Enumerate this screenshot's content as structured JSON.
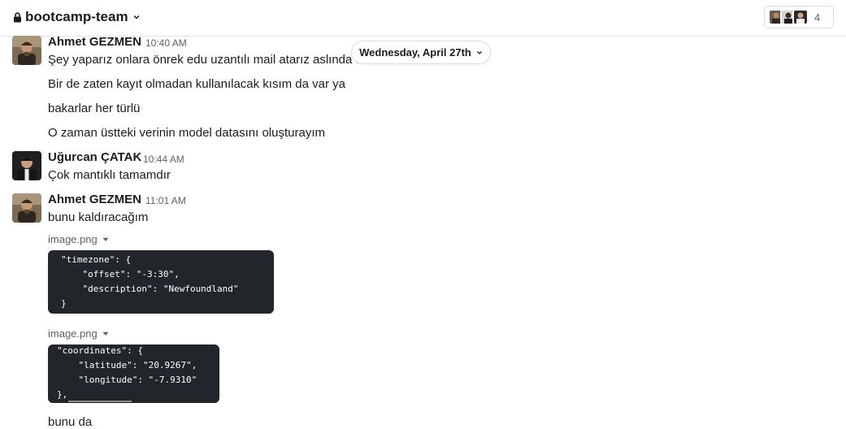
{
  "header": {
    "channel_name": "bootcamp-team",
    "member_count": "4"
  },
  "date_divider": {
    "label": "Wednesday, April 27th"
  },
  "messages": [
    {
      "author": "Ahmet GEZMEN",
      "time": "10:40 AM",
      "lines": [
        "Şey yaparız onlara önrek edu uzantılı mail atarız aslında olur",
        "Bir de zaten kayıt olmadan kullanılacak kısım da var ya",
        "bakarlar her türlü",
        "O zaman üstteki verinin model datasını oluşturayım"
      ]
    },
    {
      "author": "Uğurcan ÇATAK",
      "time": "10:44 AM",
      "lines": [
        "Çok mantıklı tamamdır"
      ]
    },
    {
      "author": "Ahmet GEZMEN",
      "time": "11:01 AM",
      "lines": [
        "bunu kaldıracağım"
      ],
      "files": [
        {
          "name": "image.png",
          "code": [
            "\"timezone\": {",
            "    \"offset\": \"-3:30\",",
            "    \"description\": \"Newfoundland\"",
            "}"
          ]
        },
        {
          "name": "image.png",
          "code": [
            "\"coordinates\": {",
            "    \"latitude\": \"20.9267\",",
            "    \"longitude\": \"-7.9310\"",
            "},"
          ]
        }
      ],
      "after": "bunu da"
    }
  ]
}
